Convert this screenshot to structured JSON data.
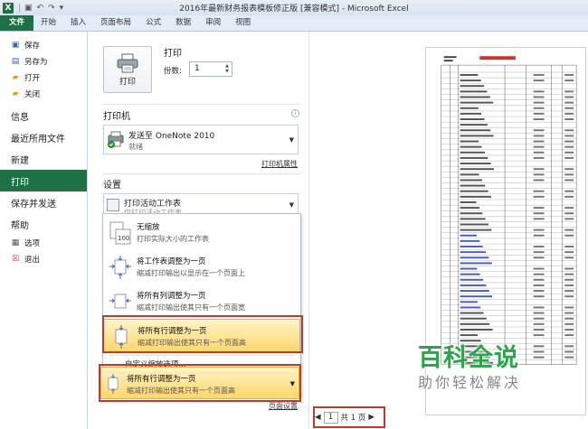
{
  "window": {
    "title": "2016年最新财务报表模板修正版 [兼容模式] - Microsoft Excel",
    "logo": "X"
  },
  "tabs": [
    {
      "label": "文件"
    },
    {
      "label": "开始"
    },
    {
      "label": "插入"
    },
    {
      "label": "页面布局"
    },
    {
      "label": "公式"
    },
    {
      "label": "数据"
    },
    {
      "label": "审阅"
    },
    {
      "label": "视图"
    }
  ],
  "nav": {
    "small_top": [
      {
        "label": "保存",
        "icon": "save-icon"
      },
      {
        "label": "另存为",
        "icon": "save-as-icon"
      },
      {
        "label": "打开",
        "icon": "folder-open-icon"
      },
      {
        "label": "关闭",
        "icon": "folder-close-icon"
      }
    ],
    "big": [
      {
        "label": "信息"
      },
      {
        "label": "最近所用文件"
      },
      {
        "label": "新建"
      },
      {
        "label": "打印"
      },
      {
        "label": "保存并发送"
      },
      {
        "label": "帮助"
      }
    ],
    "small_bottom": [
      {
        "label": "选项",
        "icon": "options-icon"
      },
      {
        "label": "退出",
        "icon": "exit-icon"
      }
    ],
    "active": "打印"
  },
  "print": {
    "heading": "打印",
    "button_label": "打印",
    "copies_label": "份数:",
    "copies_value": "1"
  },
  "printer": {
    "heading": "打印机",
    "name": "发送至 OneNote 2010",
    "status": "就绪",
    "properties_link": "打印机属性"
  },
  "settings": {
    "heading": "设置",
    "active_sheets": "打印活动工作表",
    "active_sheets_sub": "仅打印活动工作表"
  },
  "scaling_menu": {
    "options": [
      {
        "title": "无缩放",
        "desc": "打印实际大小的工作表"
      },
      {
        "title": "将工作表调整为一页",
        "desc": "缩减打印输出以显示在一个页面上"
      },
      {
        "title": "将所有列调整为一页",
        "desc": "缩减打印输出使其只有一个页面宽"
      },
      {
        "title": "将所有行调整为一页",
        "desc": "缩减打印输出使其只有一个页面高"
      }
    ],
    "custom": "自定义缩放选项..."
  },
  "scaling_selected": {
    "title": "将所有行调整为一页",
    "desc": "缩减打印输出使其只有一个页面高"
  },
  "page_setup_link": "页面设置",
  "pager": {
    "current": "1",
    "total_label": "共 1 页"
  },
  "watermark": {
    "brand": "百科全说",
    "slogan": "助你轻松解决",
    "brand_color": "#2aa64a"
  },
  "colors": {
    "excel_green": "#1e7145",
    "highlight": "#ffd76a",
    "annotation_red": "#c0392b"
  }
}
